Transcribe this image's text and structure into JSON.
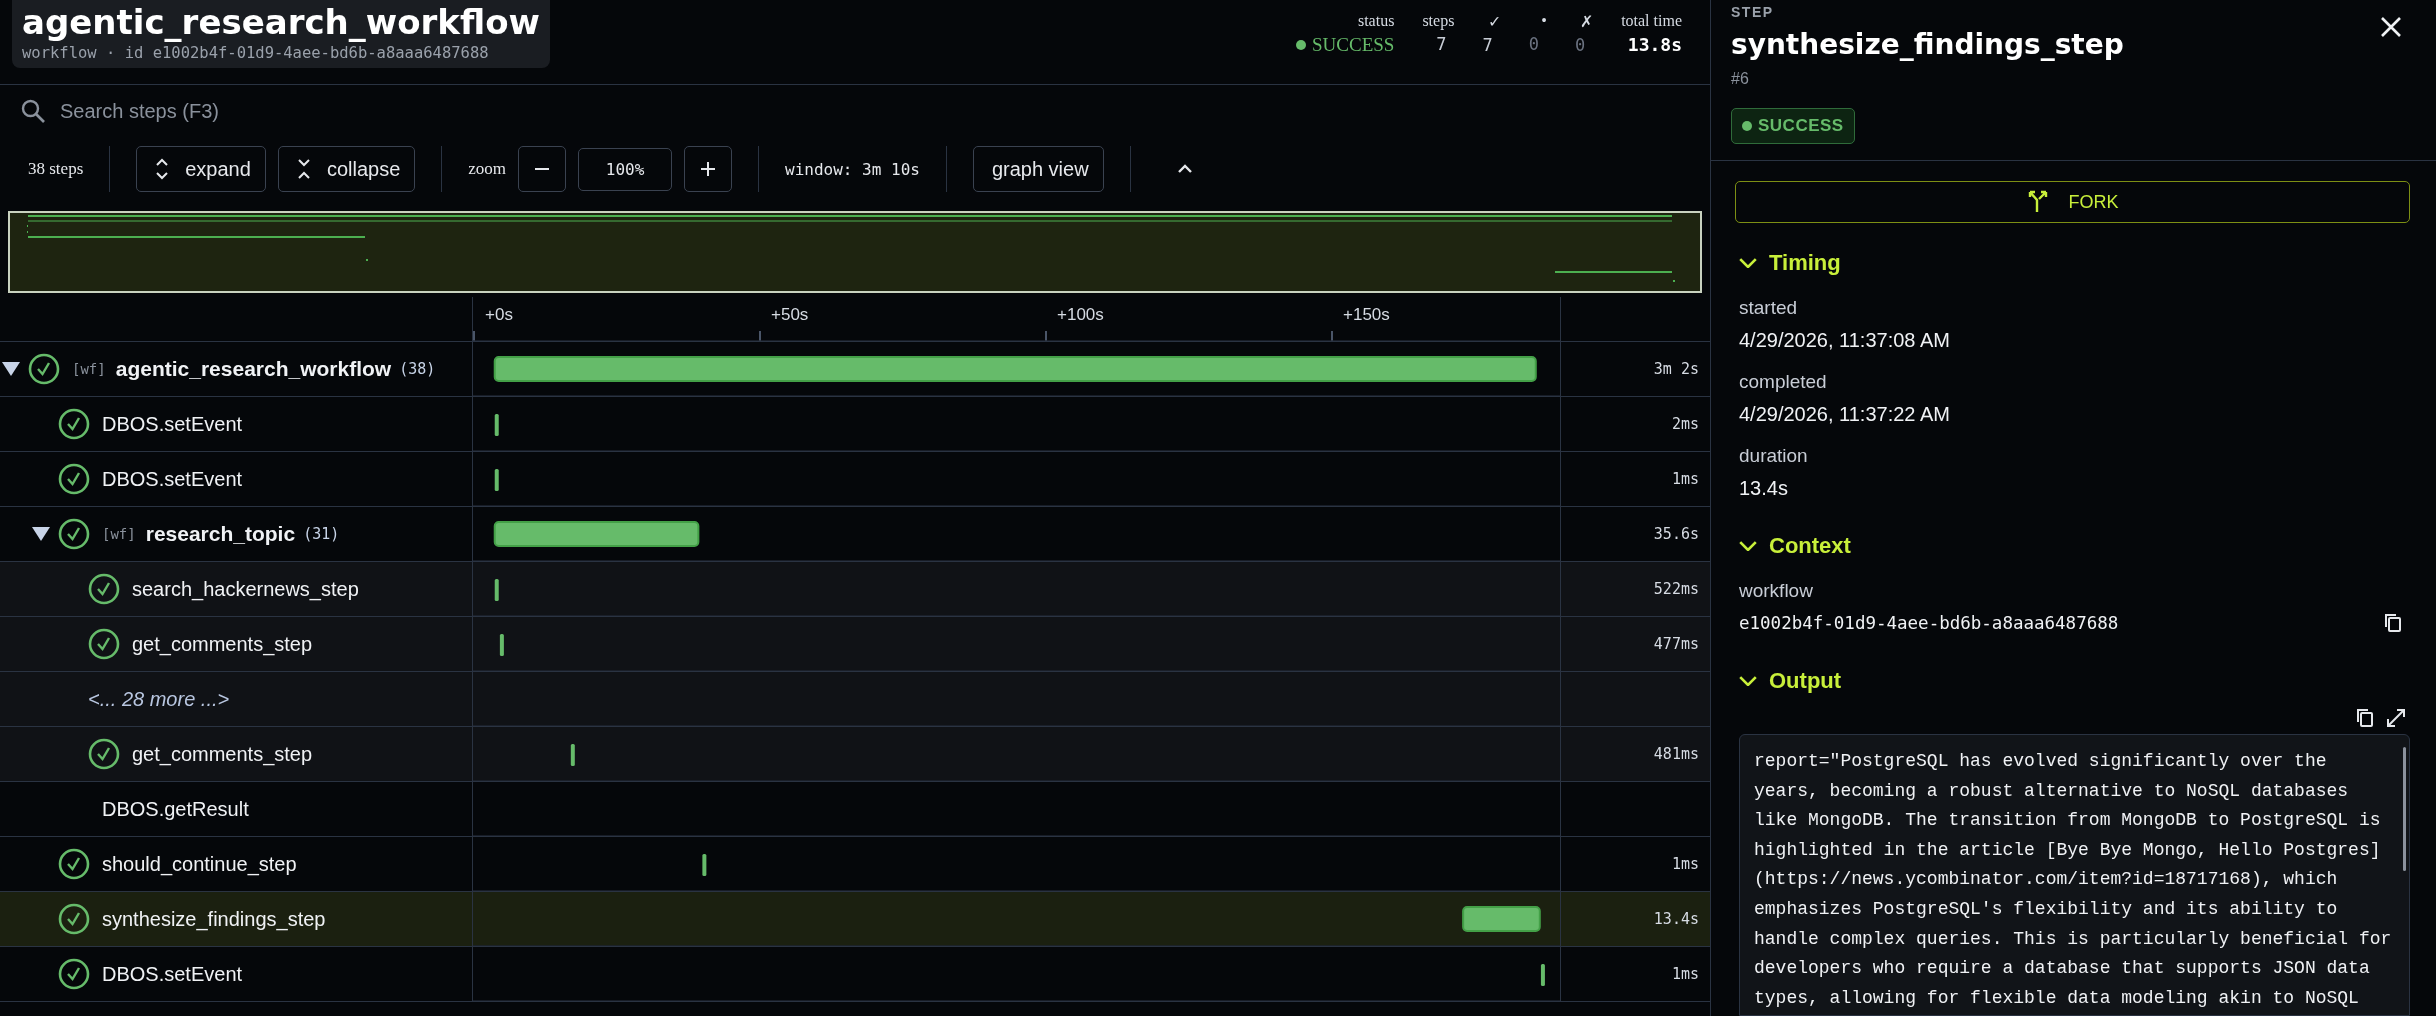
{
  "workflow": {
    "title": "agentic_research_workflow",
    "subtitle": "workflow · id e1002b4f-01d9-4aee-bd6b-a8aaa6487688"
  },
  "stats": [
    {
      "label": "status",
      "value": "SUCCESS",
      "kind": "status"
    },
    {
      "label": "steps",
      "value": "7",
      "kind": "count"
    },
    {
      "label": "✓",
      "value": "7",
      "kind": "count"
    },
    {
      "label": "•",
      "value": "0",
      "kind": "muted"
    },
    {
      "label": "✗",
      "value": "0",
      "kind": "muted"
    },
    {
      "label": "total time",
      "value": "13.8s",
      "kind": "total"
    }
  ],
  "search": {
    "placeholder": "Search steps (F3)"
  },
  "toolbar": {
    "step_count": "38 steps",
    "expand": "expand",
    "collapse": "collapse",
    "zoom_label": "zoom",
    "zoom_value": "100%",
    "window": "window: 3m 10s",
    "graph_view": "graph view"
  },
  "timeline": {
    "ticks": [
      "+0s",
      "+50s",
      "+100s",
      "+150s"
    ]
  },
  "rows": [
    {
      "kind": "workflow",
      "tag": "[wf]",
      "name": "agentic_research_workflow",
      "count": "(38)",
      "success": true,
      "expanded": true,
      "selected": false,
      "duration": "3m 2s",
      "children": [
        {
          "kind": "step",
          "name": "DBOS.setEvent",
          "success": true,
          "selected": false,
          "duration": "2ms"
        },
        {
          "kind": "step",
          "name": "DBOS.setEvent",
          "success": true,
          "selected": false,
          "duration": "1ms"
        },
        {
          "kind": "workflow",
          "tag": "[wf]",
          "name": "research_topic",
          "count": "(31)",
          "success": true,
          "expanded": true,
          "selected": false,
          "duration": "35.6s",
          "children": [
            {
              "kind": "step",
              "name": "search_hackernews_step",
              "success": true,
              "selected": false,
              "duration": "522ms"
            },
            {
              "kind": "step",
              "name": "get_comments_step",
              "success": true,
              "selected": false,
              "duration": "477ms"
            },
            {
              "kind": "more",
              "name": "<... 28 more ...>",
              "selected": false
            },
            {
              "kind": "step",
              "name": "get_comments_step",
              "success": true,
              "selected": false,
              "duration": "481ms"
            }
          ]
        },
        {
          "kind": "step",
          "name": "DBOS.getResult",
          "success": false,
          "selected": false
        },
        {
          "kind": "step",
          "name": "should_continue_step",
          "success": true,
          "selected": false,
          "duration": "1ms"
        },
        {
          "kind": "step",
          "name": "synthesize_findings_step",
          "success": true,
          "selected": true,
          "duration": "13.4s"
        },
        {
          "kind": "step",
          "name": "DBOS.setEvent",
          "success": true,
          "selected": false,
          "duration": "1ms"
        }
      ]
    }
  ],
  "detail": {
    "eyebrow": "STEP",
    "title": "synthesize_findings_step",
    "number": "#6",
    "status": {
      "label": "SUCCESS",
      "kind": "success"
    },
    "fork": "FORK",
    "sections": [
      {
        "kind": "fields",
        "title": "Timing",
        "expanded": true,
        "fields": [
          {
            "kind": "text",
            "label": "started",
            "value": "4/29/2026, 11:37:08 AM"
          },
          {
            "kind": "text",
            "label": "completed",
            "value": "4/29/2026, 11:37:22 AM"
          },
          {
            "kind": "text",
            "label": "duration",
            "value": "13.4s"
          }
        ]
      },
      {
        "kind": "fields",
        "title": "Context",
        "expanded": true,
        "fields": [
          {
            "kind": "copyable",
            "label": "workflow",
            "value": "e1002b4f-01d9-4aee-bd6b-a8aaa6487688"
          }
        ]
      },
      {
        "kind": "output",
        "title": "Output",
        "expanded": true,
        "text": "report=\"PostgreSQL has evolved significantly over the years, becoming a robust alternative to NoSQL databases like MongoDB. The transition from MongoDB to PostgreSQL is highlighted in the article [Bye Bye Mongo, Hello Postgres] (https://news.ycombinator.com/item?id=18717168), which emphasizes PostgreSQL's flexibility and its ability to handle complex queries. This is particularly beneficial for developers who require a database that supports JSON data types, allowing for flexible data modeling akin to NoSQL"
      }
    ]
  }
}
